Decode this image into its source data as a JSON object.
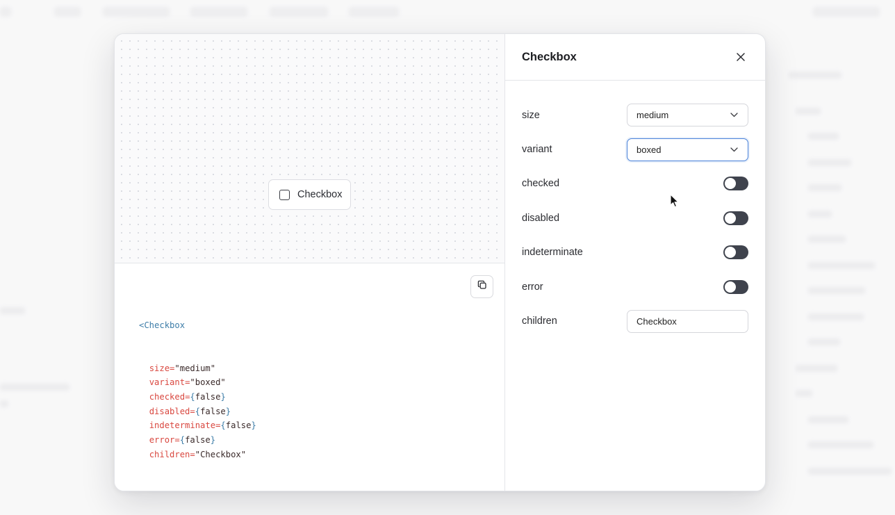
{
  "panel": {
    "title": "Checkbox"
  },
  "preview": {
    "checkbox_label": "Checkbox"
  },
  "props": [
    {
      "label": "size",
      "type": "select",
      "value": "medium"
    },
    {
      "label": "variant",
      "type": "select",
      "value": "boxed",
      "focused": true
    },
    {
      "label": "checked",
      "type": "toggle",
      "value": false
    },
    {
      "label": "disabled",
      "type": "toggle",
      "value": false
    },
    {
      "label": "indeterminate",
      "type": "toggle",
      "value": false
    },
    {
      "label": "error",
      "type": "toggle",
      "value": false
    },
    {
      "label": "children",
      "type": "text",
      "value": "Checkbox"
    }
  ],
  "code": {
    "component": "Checkbox",
    "lines": [
      {
        "attr": "size",
        "value": "\"medium\""
      },
      {
        "attr": "variant",
        "value": "\"boxed\""
      },
      {
        "attr": "checked",
        "value": "{false}"
      },
      {
        "attr": "disabled",
        "value": "{false}"
      },
      {
        "attr": "indeterminate",
        "value": "{false}"
      },
      {
        "attr": "error",
        "value": "{false}"
      },
      {
        "attr": "children",
        "value": "\"Checkbox\""
      }
    ]
  },
  "icons": {
    "close": "close-icon",
    "copy": "copy-icon",
    "chevron": "chevron-down-icon"
  },
  "colors": {
    "accent": "#4a82d9",
    "toggle_off": "#3f434d",
    "code_tag": "#3d7da8",
    "code_attr": "#d9473f"
  }
}
